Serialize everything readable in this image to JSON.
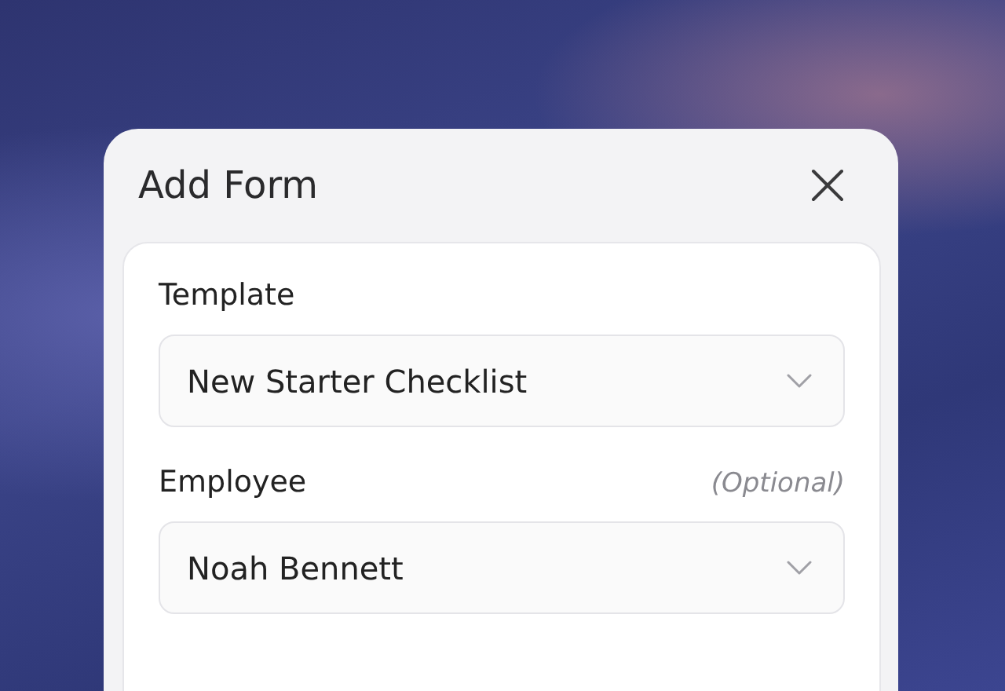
{
  "dialog": {
    "title": "Add Form"
  },
  "fields": [
    {
      "label": "Template",
      "value": "New Starter Checklist"
    },
    {
      "label": "Employee",
      "hint": "(Optional)",
      "value": "Noah Bennett"
    }
  ]
}
